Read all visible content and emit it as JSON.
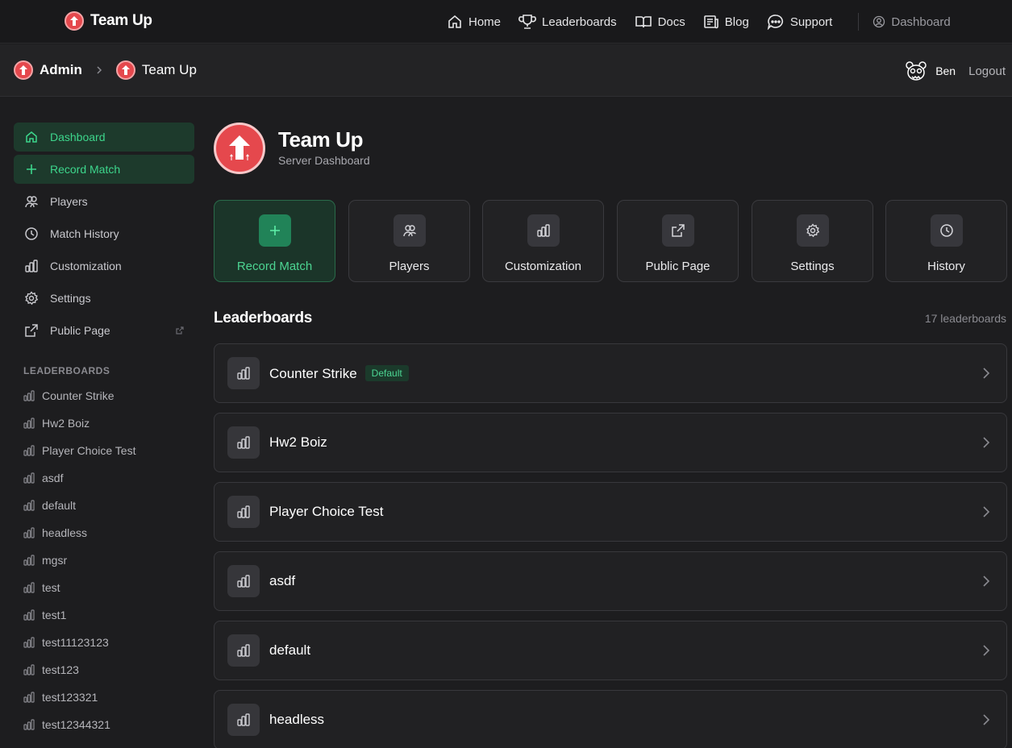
{
  "topnav": {
    "brand": "Team Up",
    "links": [
      {
        "label": "Home",
        "icon": "home-icon"
      },
      {
        "label": "Leaderboards",
        "icon": "trophy-icon"
      },
      {
        "label": "Docs",
        "icon": "book-icon"
      },
      {
        "label": "Blog",
        "icon": "newspaper-icon"
      },
      {
        "label": "Support",
        "icon": "chat-icon"
      }
    ],
    "dashboard": "Dashboard"
  },
  "breadcrumb": {
    "admin": "Admin",
    "server": "Team Up"
  },
  "user": {
    "name": "Ben",
    "logout": "Logout"
  },
  "sidebar": {
    "items": [
      {
        "label": "Dashboard",
        "icon": "home-icon"
      },
      {
        "label": "Record Match",
        "icon": "plus-icon"
      },
      {
        "label": "Players",
        "icon": "users-icon"
      },
      {
        "label": "Match History",
        "icon": "clock-icon"
      },
      {
        "label": "Customization",
        "icon": "bar-chart-icon"
      },
      {
        "label": "Settings",
        "icon": "gear-icon"
      },
      {
        "label": "Public Page",
        "icon": "external-link-icon"
      }
    ],
    "section_label": "LEADERBOARDS",
    "leaderboards": [
      "Counter Strike",
      "Hw2 Boiz",
      "Player Choice Test",
      "asdf",
      "default",
      "headless",
      "mgsr",
      "test",
      "test1",
      "test11123123",
      "test123",
      "test123321",
      "test12344321"
    ]
  },
  "header": {
    "title": "Team Up",
    "subtitle": "Server Dashboard"
  },
  "quick_actions": [
    {
      "label": "Record Match",
      "icon": "plus-icon"
    },
    {
      "label": "Players",
      "icon": "users-icon"
    },
    {
      "label": "Customization",
      "icon": "bar-chart-icon"
    },
    {
      "label": "Public Page",
      "icon": "external-link-icon"
    },
    {
      "label": "Settings",
      "icon": "gear-icon"
    },
    {
      "label": "History",
      "icon": "clock-icon"
    }
  ],
  "leaderboards": {
    "title": "Leaderboards",
    "count": "17 leaderboards",
    "default_badge": "Default",
    "rows": [
      "Counter Strike",
      "Hw2 Boiz",
      "Player Choice Test",
      "asdf",
      "default",
      "headless"
    ]
  },
  "colors": {
    "accent": "#3dd68c",
    "brand": "#e5484d",
    "background": "#1d1d1f"
  }
}
